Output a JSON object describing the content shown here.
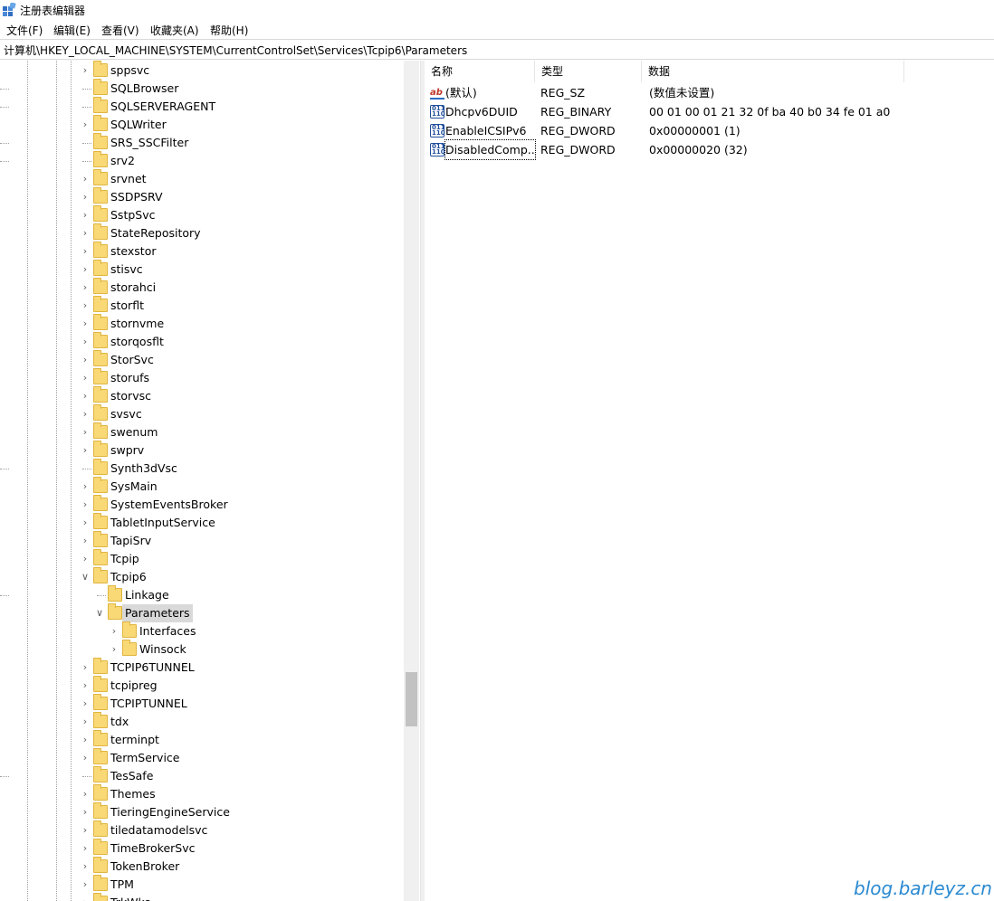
{
  "window": {
    "title": "注册表编辑器"
  },
  "menu": [
    "文件(F)",
    "编辑(E)",
    "查看(V)",
    "收藏夹(A)",
    "帮助(H)"
  ],
  "address": "计算机\\HKEY_LOCAL_MACHINE\\SYSTEM\\CurrentControlSet\\Services\\Tcpip6\\Parameters",
  "tree": [
    {
      "label": "sppsvc",
      "level": 0,
      "expander": "collapsed"
    },
    {
      "label": "SQLBrowser",
      "level": 0,
      "expander": "none"
    },
    {
      "label": "SQLSERVERAGENT",
      "level": 0,
      "expander": "none"
    },
    {
      "label": "SQLWriter",
      "level": 0,
      "expander": "collapsed"
    },
    {
      "label": "SRS_SSCFilter",
      "level": 0,
      "expander": "none"
    },
    {
      "label": "srv2",
      "level": 0,
      "expander": "none"
    },
    {
      "label": "srvnet",
      "level": 0,
      "expander": "collapsed"
    },
    {
      "label": "SSDPSRV",
      "level": 0,
      "expander": "collapsed"
    },
    {
      "label": "SstpSvc",
      "level": 0,
      "expander": "collapsed"
    },
    {
      "label": "StateRepository",
      "level": 0,
      "expander": "collapsed"
    },
    {
      "label": "stexstor",
      "level": 0,
      "expander": "collapsed"
    },
    {
      "label": "stisvc",
      "level": 0,
      "expander": "collapsed"
    },
    {
      "label": "storahci",
      "level": 0,
      "expander": "collapsed"
    },
    {
      "label": "storflt",
      "level": 0,
      "expander": "collapsed"
    },
    {
      "label": "stornvme",
      "level": 0,
      "expander": "collapsed"
    },
    {
      "label": "storqosflt",
      "level": 0,
      "expander": "collapsed"
    },
    {
      "label": "StorSvc",
      "level": 0,
      "expander": "collapsed"
    },
    {
      "label": "storufs",
      "level": 0,
      "expander": "collapsed"
    },
    {
      "label": "storvsc",
      "level": 0,
      "expander": "collapsed"
    },
    {
      "label": "svsvc",
      "level": 0,
      "expander": "collapsed"
    },
    {
      "label": "swenum",
      "level": 0,
      "expander": "collapsed"
    },
    {
      "label": "swprv",
      "level": 0,
      "expander": "collapsed"
    },
    {
      "label": "Synth3dVsc",
      "level": 0,
      "expander": "none"
    },
    {
      "label": "SysMain",
      "level": 0,
      "expander": "collapsed"
    },
    {
      "label": "SystemEventsBroker",
      "level": 0,
      "expander": "collapsed"
    },
    {
      "label": "TabletInputService",
      "level": 0,
      "expander": "collapsed"
    },
    {
      "label": "TapiSrv",
      "level": 0,
      "expander": "collapsed"
    },
    {
      "label": "Tcpip",
      "level": 0,
      "expander": "collapsed"
    },
    {
      "label": "Tcpip6",
      "level": 0,
      "expander": "expanded"
    },
    {
      "label": "Linkage",
      "level": 1,
      "expander": "none"
    },
    {
      "label": "Parameters",
      "level": 1,
      "expander": "expanded",
      "selected": true
    },
    {
      "label": "Interfaces",
      "level": 2,
      "expander": "collapsed"
    },
    {
      "label": "Winsock",
      "level": 2,
      "expander": "collapsed"
    },
    {
      "label": "TCPIP6TUNNEL",
      "level": 0,
      "expander": "collapsed"
    },
    {
      "label": "tcpipreg",
      "level": 0,
      "expander": "collapsed"
    },
    {
      "label": "TCPIPTUNNEL",
      "level": 0,
      "expander": "collapsed"
    },
    {
      "label": "tdx",
      "level": 0,
      "expander": "collapsed"
    },
    {
      "label": "terminpt",
      "level": 0,
      "expander": "collapsed"
    },
    {
      "label": "TermService",
      "level": 0,
      "expander": "collapsed"
    },
    {
      "label": "TesSafe",
      "level": 0,
      "expander": "none"
    },
    {
      "label": "Themes",
      "level": 0,
      "expander": "collapsed"
    },
    {
      "label": "TieringEngineService",
      "level": 0,
      "expander": "collapsed"
    },
    {
      "label": "tiledatamodelsvc",
      "level": 0,
      "expander": "collapsed"
    },
    {
      "label": "TimeBrokerSvc",
      "level": 0,
      "expander": "collapsed"
    },
    {
      "label": "TokenBroker",
      "level": 0,
      "expander": "collapsed"
    },
    {
      "label": "TPM",
      "level": 0,
      "expander": "collapsed"
    },
    {
      "label": "TrkWks",
      "level": 0,
      "expander": "collapsed"
    }
  ],
  "list": {
    "columns": [
      "名称",
      "类型",
      "数据"
    ],
    "rows": [
      {
        "icon": "string-value-icon",
        "name": "(默认)",
        "type": "REG_SZ",
        "data": "(数值未设置)"
      },
      {
        "icon": "binary-value-icon",
        "name": "Dhcpv6DUID",
        "type": "REG_BINARY",
        "data": "00 01 00 01 21 32 0f ba 40 b0 34 fe 01 a0"
      },
      {
        "icon": "binary-value-icon",
        "name": "EnableICSIPv6",
        "type": "REG_DWORD",
        "data": "0x00000001 (1)"
      },
      {
        "icon": "binary-value-icon",
        "name": "DisabledComp...",
        "type": "REG_DWORD",
        "data": "0x00000020 (32)",
        "focused": true
      }
    ]
  },
  "icons": {
    "string": "ab",
    "binary": "011\n110"
  },
  "watermark": "blog.barleyz.cn"
}
